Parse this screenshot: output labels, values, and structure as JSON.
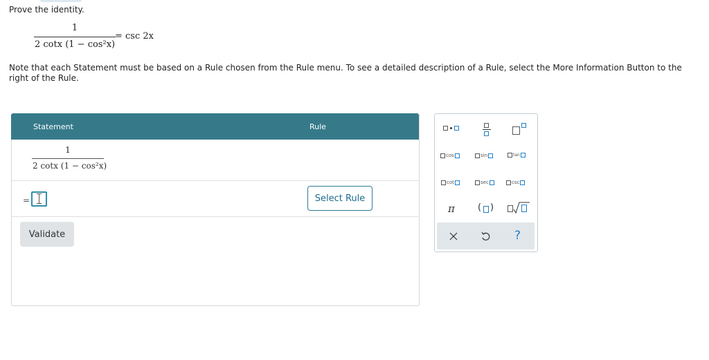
{
  "prompt": {
    "heading": "Prove the identity.",
    "identity_numerator": "1",
    "identity_denominator": "2 cotx (1 − cos²x)",
    "identity_rhs": "= csc 2x"
  },
  "instructions": "Note that each Statement must be based on a Rule chosen from the Rule menu. To see a detailed description of a Rule, select the More Information Button to the right of the Rule.",
  "proof_table": {
    "column_statement": "Statement",
    "column_rule": "Rule",
    "row1_numerator": "1",
    "row1_denominator": "2 cotx (1 − cos²x)",
    "row2_equals": "=",
    "select_rule_label": "Select Rule",
    "validate_label": "Validate"
  },
  "palette": {
    "fn_cos": "cos",
    "fn_sin": "sin",
    "fn_tan": "tan",
    "fn_cot": "cot",
    "fn_sec": "sec",
    "fn_csc": "csc",
    "pi": "π",
    "help": "?"
  },
  "colors": {
    "header_bg": "#367a8a",
    "accent": "#1f6c8c",
    "input_border": "#2f8fa8",
    "palette_blue": "#1e7fc6"
  }
}
